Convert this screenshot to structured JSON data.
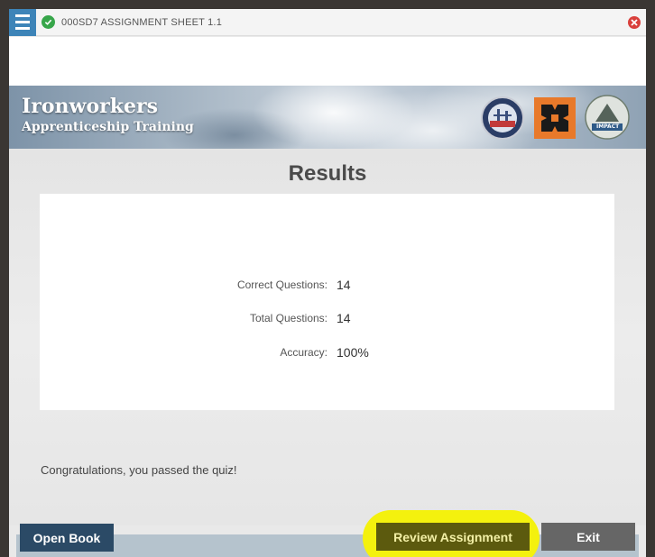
{
  "window": {
    "title": "000SD7 ASSIGNMENT SHEET 1.1"
  },
  "banner": {
    "brand_line1": "Ironworkers",
    "brand_line2": "Apprenticeship Training",
    "logo_badge_text": "IMPACT"
  },
  "results": {
    "heading": "Results",
    "stats": [
      {
        "label": "Correct Questions:",
        "value": "14"
      },
      {
        "label": "Total Questions:",
        "value": "14"
      },
      {
        "label": "Accuracy:",
        "value": "100%"
      }
    ],
    "message": "Congratulations, you passed the quiz!"
  },
  "footer": {
    "open_book_label": "Open Book",
    "review_label": "Review Assignment",
    "exit_label": "Exit"
  },
  "colors": {
    "menu_blue": "#3d84b8",
    "check_green": "#37a64a",
    "close_red": "#d9403c",
    "open_book_bg": "#2b4a66",
    "highlight_yellow": "#f4f10e",
    "exit_gray": "#666666"
  },
  "icons": [
    "menu-icon",
    "check-circle-icon",
    "close-circle-icon"
  ]
}
